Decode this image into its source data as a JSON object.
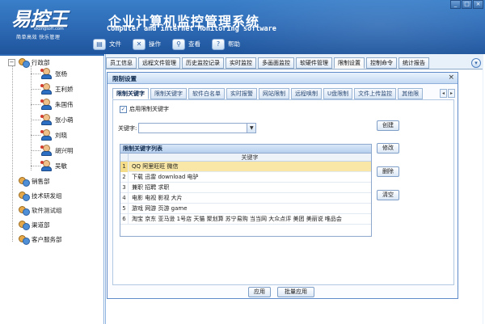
{
  "app": {
    "brand": "易控王",
    "site": "ekongsoft.com",
    "slogan": "简单高效  快乐管理",
    "title_zh": "企业计算机监控管理系统",
    "title_en": "Computer and internet Monitoring software",
    "window_buttons": [
      "_",
      "□",
      "×"
    ]
  },
  "toolbar": [
    {
      "label": "文件",
      "icon": "file-icon"
    },
    {
      "label": "操作",
      "icon": "tools-icon"
    },
    {
      "label": "查看",
      "icon": "view-icon"
    },
    {
      "label": "帮助",
      "icon": "help-icon"
    }
  ],
  "tree": {
    "root": {
      "label": "行政部",
      "expanded": true
    },
    "users": [
      "张杨",
      "王利娇",
      "朱国伟",
      "张小萌",
      "刘晓",
      "胡兴明",
      "吴敏"
    ],
    "departments": [
      "销售部",
      "技术研发组",
      "软件测试组",
      "渠道部",
      "客户服务部"
    ]
  },
  "main_tabs": {
    "items": [
      "员工信息",
      "远程文件管理",
      "历史监控记录",
      "实时监控",
      "多画面监控",
      "软硬件管理",
      "限制设置",
      "控制命令",
      "统计报告"
    ],
    "active": "限制设置"
  },
  "dialog": {
    "title": "限制设置",
    "close": "×",
    "tabs": [
      "限制关键字",
      "限制关键字",
      "软件白名单",
      "实时报警",
      "网站限制",
      "远程唤制",
      "U盘限制",
      "文件上传监控",
      "其他限"
    ],
    "active_tab": "限制关键字",
    "enable_label": "启用限制关键字",
    "enable_checked": true,
    "keyword_label": "关键字:",
    "keyword_value": "",
    "list_caption": "限制关键字列表",
    "list_header": "关键字",
    "rows": [
      {
        "n": "1",
        "v": "QQ 阿里旺旺 微信"
      },
      {
        "n": "2",
        "v": "下载 迅雷 download 电驴"
      },
      {
        "n": "3",
        "v": "兼职 招聘 求职"
      },
      {
        "n": "4",
        "v": "电影 电视 影视 大片"
      },
      {
        "n": "5",
        "v": "游戏 网游 页游 game"
      },
      {
        "n": "6",
        "v": "淘宝 京东 亚马逊 1号店 天猫 聚划算 苏宁易购 当当网 大众点评 美团 美丽说 唯品会"
      }
    ],
    "selected_row": 0,
    "buttons": {
      "create": "创建",
      "modify": "修改",
      "delete": "删除",
      "clear": "清空"
    },
    "footer": {
      "apply": "应用",
      "batch_apply": "批量应用"
    }
  },
  "colors": {
    "header": "#2c68b3",
    "selection": "#f8e7a6",
    "panel_bg": "#e8f0fa"
  }
}
